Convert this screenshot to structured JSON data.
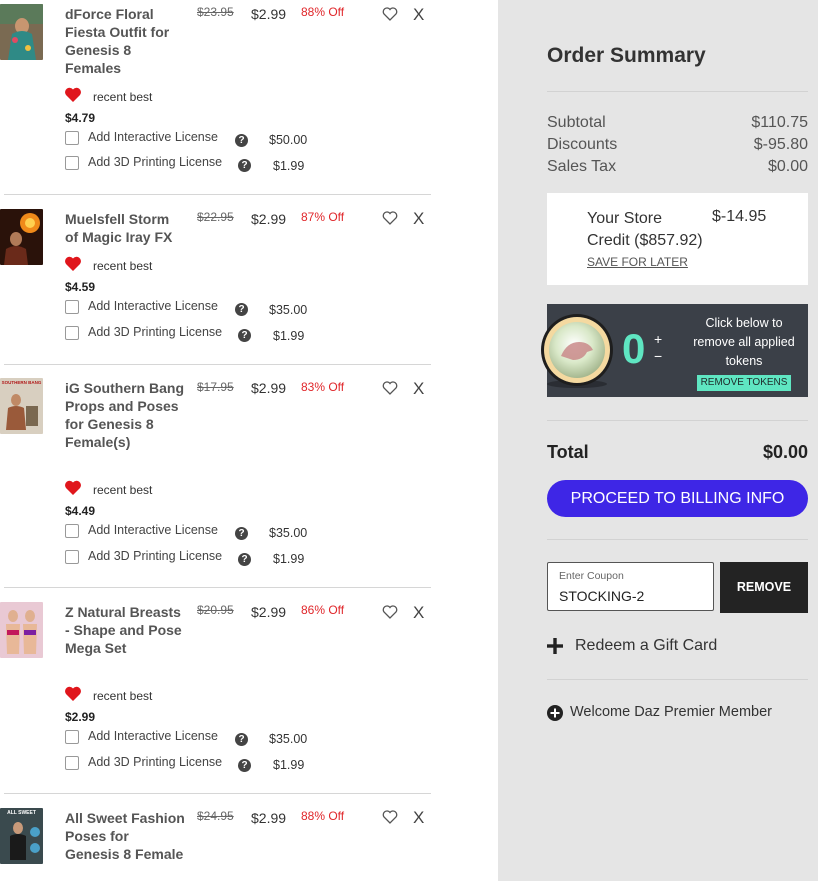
{
  "cart": {
    "items": [
      {
        "name": "dForce Floral Fiesta Outfit for Genesis 8 Females",
        "original_price": "$23.95",
        "price": "$2.99",
        "discount": "88% Off",
        "tag": "recent best",
        "sale_price": "$4.79",
        "licenses": [
          {
            "label": "Add Interactive License",
            "price": "$50.00"
          },
          {
            "label": "Add 3D Printing License",
            "price": "$1.99"
          }
        ]
      },
      {
        "name": "Muelsfell Storm of Magic Iray FX",
        "original_price": "$22.95",
        "price": "$2.99",
        "discount": "87% Off",
        "tag": "recent best",
        "sale_price": "$4.59",
        "licenses": [
          {
            "label": "Add Interactive License",
            "price": "$35.00"
          },
          {
            "label": "Add 3D Printing License",
            "price": "$1.99"
          }
        ]
      },
      {
        "name": "iG Southern Bang Props and Poses for Genesis 8 Female(s)",
        "original_price": "$17.95",
        "price": "$2.99",
        "discount": "83% Off",
        "tag": "recent best",
        "sale_price": "$4.49",
        "thumb_caption": "SOUTHERN BANG",
        "licenses": [
          {
            "label": "Add Interactive License",
            "price": "$35.00"
          },
          {
            "label": "Add 3D Printing License",
            "price": "$1.99"
          }
        ]
      },
      {
        "name": "Z Natural Breasts - Shape and Pose Mega Set",
        "original_price": "$20.95",
        "price": "$2.99",
        "discount": "86% Off",
        "tag": "recent best",
        "sale_price": "$2.99",
        "licenses": [
          {
            "label": "Add Interactive License",
            "price": "$35.00"
          },
          {
            "label": "Add 3D Printing License",
            "price": "$1.99"
          }
        ]
      },
      {
        "name": "All Sweet Fashion Poses for Genesis 8 Female",
        "original_price": "$24.95",
        "price": "$2.99",
        "discount": "88% Off",
        "thumb_caption": "ALL SWEET"
      }
    ],
    "remove_symbol": "X",
    "help_symbol": "?"
  },
  "summary": {
    "title": "Order Summary",
    "subtotal_label": "Subtotal",
    "subtotal_value": "$110.75",
    "discounts_label": "Discounts",
    "discounts_value": "$-95.80",
    "tax_label": "Sales Tax",
    "tax_value": "$0.00",
    "credit_label": "Your Store Credit ($857.92)",
    "credit_value": "$-14.95",
    "save_for_later": "SAVE FOR LATER",
    "token_count": "0",
    "token_plus": "+",
    "token_minus": "−",
    "token_text": "Click below to remove all applied tokens",
    "remove_tokens": "REMOVE TOKENS",
    "total_label": "Total",
    "total_value": "$0.00",
    "proceed": "PROCEED TO BILLING INFO",
    "coupon_placeholder": "Enter Coupon",
    "coupon_value": "STOCKING-2",
    "coupon_remove": "REMOVE",
    "gift_card": "Redeem a Gift Card",
    "member": "Welcome Daz Premier Member"
  },
  "colors": {
    "accent": "#3e26e6",
    "token": "#5fe6c2",
    "discount": "#e0262a",
    "heart": "#e0161c",
    "panel": "#e5e5e5"
  },
  "icons": [
    "heart-outline-icon",
    "heart-filled-icon",
    "help-icon",
    "close-icon",
    "plus-icon",
    "plus-circle-icon",
    "token-coin-icon"
  ]
}
